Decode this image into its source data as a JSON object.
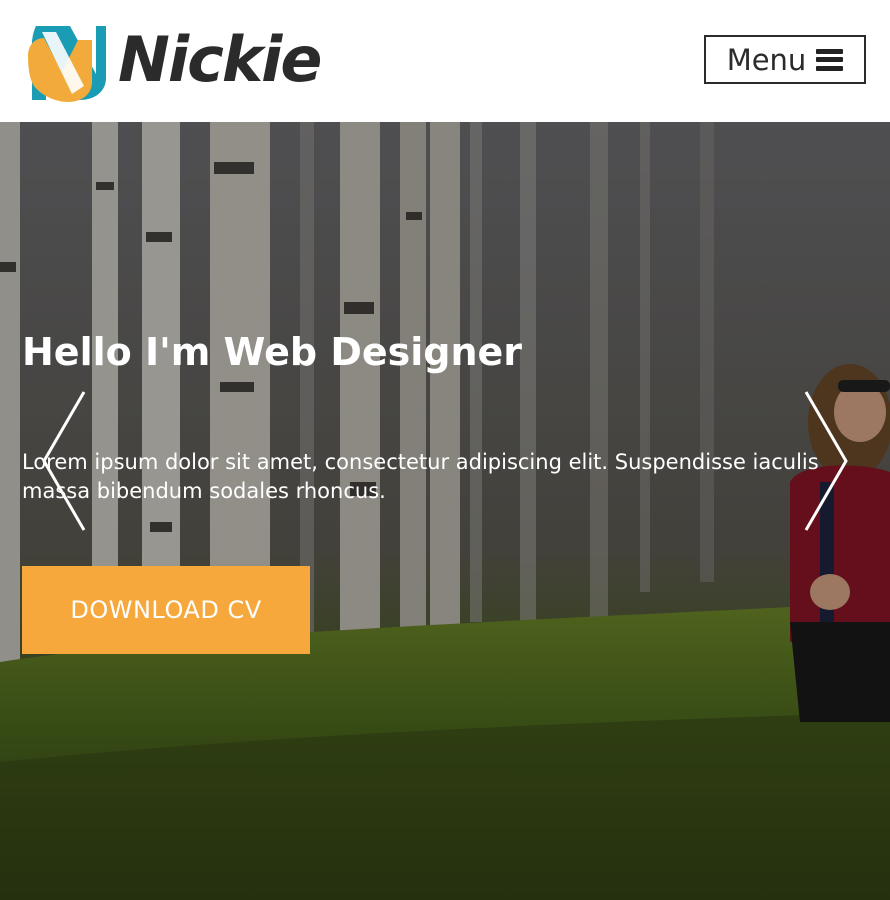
{
  "header": {
    "logo_text": "Nickie",
    "logo_icon": "n-logo-icon",
    "menu_label": "Menu",
    "menu_icon": "hamburger-icon"
  },
  "hero": {
    "title": "Hello I'm Web Designer",
    "description": "Lorem ipsum dolor sit amet, consectetur adipiscing elit. Suspendisse iaculis massa bibendum sodales rhoncus.",
    "cta_label": "DOWNLOAD CV",
    "prev_icon": "chevron-left-icon",
    "next_icon": "chevron-right-icon"
  },
  "colors": {
    "accent": "#f7a83c",
    "logo_teal": "#1a9cb4",
    "logo_orange": "#f2ab3a",
    "text_dark": "#2b2b2b"
  }
}
